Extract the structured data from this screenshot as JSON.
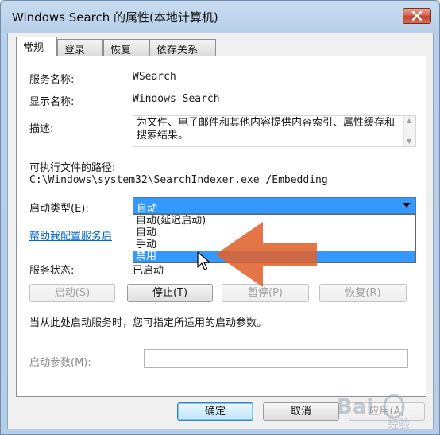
{
  "window": {
    "title": "Windows Search 的属性(本地计算机)"
  },
  "tabs": [
    {
      "label": "常规",
      "active": true
    },
    {
      "label": "登录",
      "active": false
    },
    {
      "label": "恢复",
      "active": false
    },
    {
      "label": "依存关系",
      "active": false
    }
  ],
  "general": {
    "service_name_label": "服务名称:",
    "service_name_value": "WSearch",
    "display_name_label": "显示名称:",
    "display_name_value": "Windows Search",
    "description_label": "描述:",
    "description_value": "为文件、电子邮件和其他内容提供内容索引、属性缓存和搜索结果。",
    "exe_path_label": "可执行文件的路径:",
    "exe_path_value": "C:\\Windows\\system32\\SearchIndexer.exe /Embedding",
    "startup_type_label": "启动类型(E):",
    "startup_type_value": "自动",
    "startup_options": [
      "自动(延迟启动)",
      "自动",
      "手动",
      "禁用"
    ],
    "startup_highlighted": "禁用",
    "help_link": "帮助我配置服务启",
    "status_label": "服务状态:",
    "status_value": "已启动",
    "start_button": "启动(S)",
    "stop_button": "停止(T)",
    "pause_button": "暂停(P)",
    "resume_button": "恢复(R)",
    "hint_text": "当从此处启动服务时，您可指定所适用的启动参数。",
    "start_params_label": "启动参数(M):",
    "start_params_value": ""
  },
  "footer": {
    "ok_button": "确定",
    "cancel_button": "取消",
    "apply_button": "应用(A)"
  },
  "watermark": {
    "text": "Bai 经验"
  },
  "colors": {
    "accent": "#3399ff",
    "arrow": "#e0622e",
    "link": "#0066cc"
  }
}
